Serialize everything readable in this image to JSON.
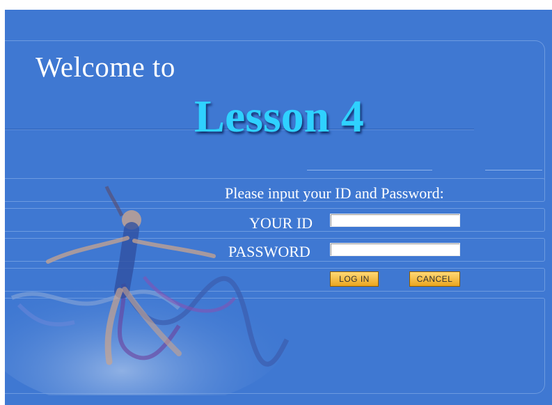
{
  "header": {
    "welcome": "Welcome to",
    "lesson": "Lesson 4"
  },
  "login": {
    "prompt": "Please input your ID and Password:",
    "id_label": "YOUR ID",
    "id_value": "",
    "password_label": "PASSWORD",
    "password_value": "",
    "login_button": "LOG IN",
    "cancel_button": "CANCEL"
  },
  "colors": {
    "background": "#3f78d2",
    "title_accent": "#2fd1ff",
    "button": "#f2bd3e"
  },
  "icons": {
    "illustration": "rhythmic-gymnast-with-ribbon"
  }
}
